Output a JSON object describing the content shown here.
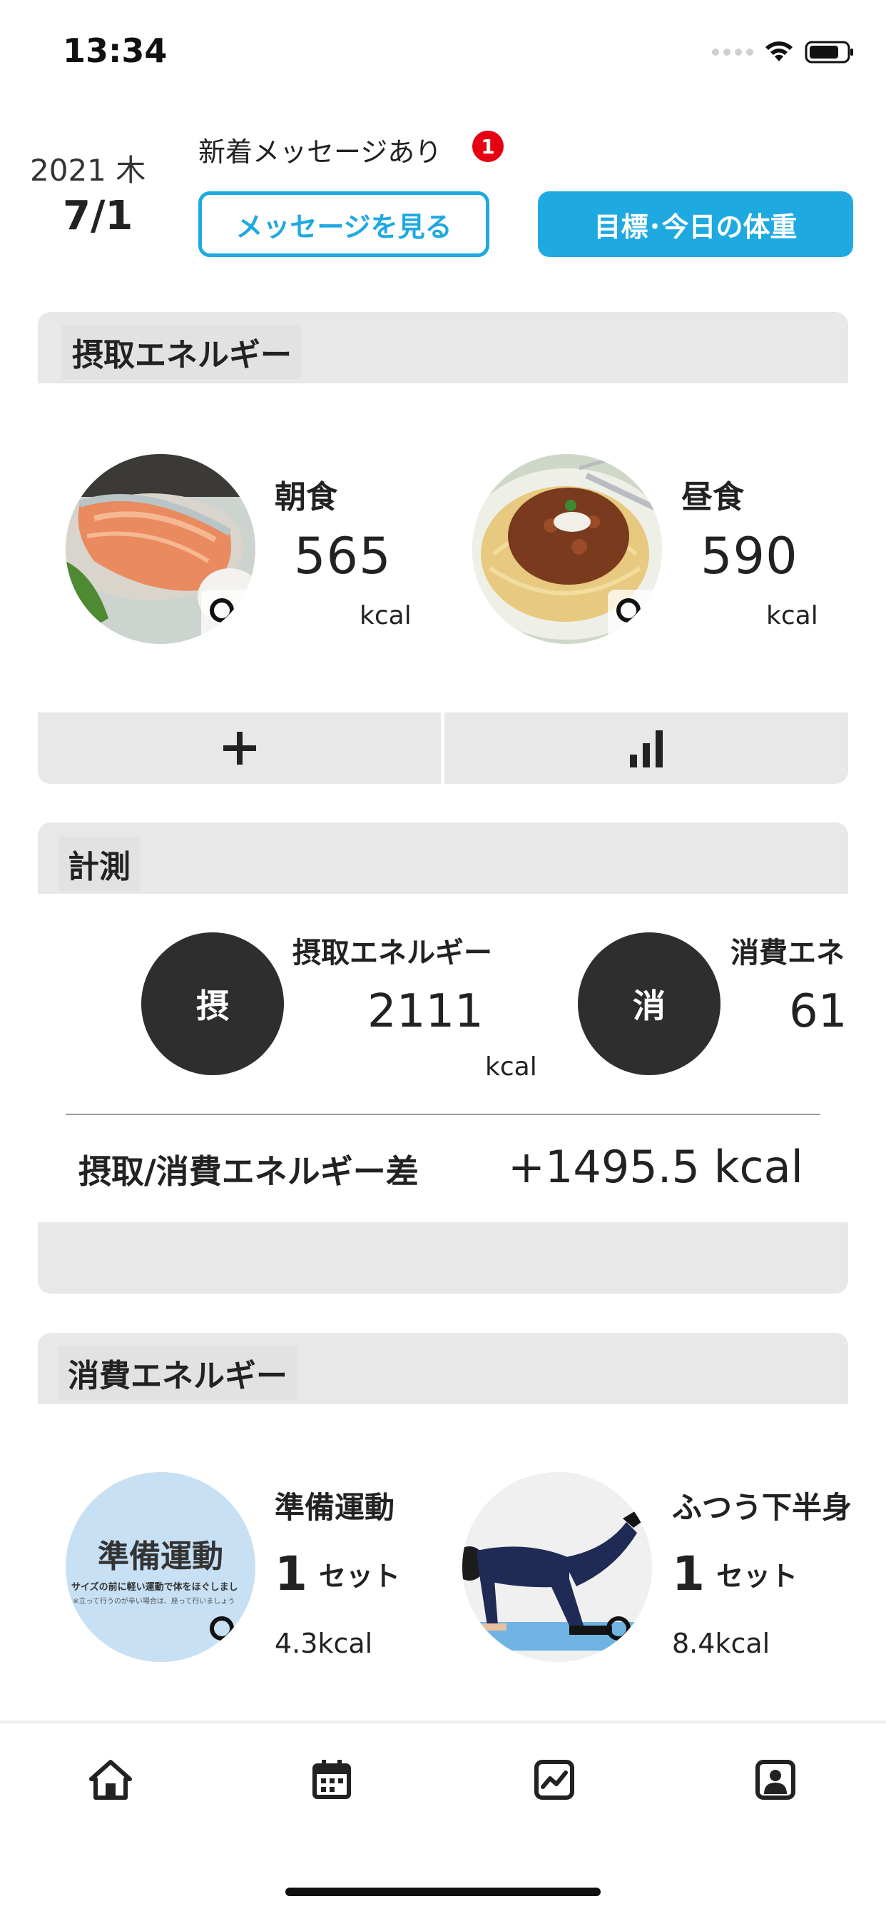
{
  "status": {
    "time": "13:34"
  },
  "header": {
    "year_weekday": "2021 木",
    "date": "7/1",
    "message_notice": "新着メッセージあり",
    "badge_count": "1",
    "view_messages_label": "メッセージを見る",
    "goal_weight_label": "目標･今日の体重",
    "accent_color": "#1fa9e1"
  },
  "intake": {
    "title": "摂取エネルギー",
    "meals": [
      {
        "label": "朝食",
        "value": "565",
        "unit": "kcal",
        "photo": "grilled-salmon"
      },
      {
        "label": "昼食",
        "value": "590",
        "unit": "kcal",
        "photo": "meat-sauce-spaghetti"
      }
    ],
    "add_icon": "plus-icon",
    "chart_icon": "bar-chart-icon"
  },
  "measure": {
    "title": "計測",
    "items": [
      {
        "badge": "摂",
        "label": "摂取エネルギー",
        "value": "2111",
        "unit": "kcal"
      },
      {
        "badge": "消",
        "label": "消費エネ",
        "value": "61"
      }
    ],
    "diff_label": "摂取/消費エネルギー差",
    "diff_value": "+1495.5 kcal"
  },
  "burn": {
    "title": "消費エネルギー",
    "exercises": [
      {
        "label": "準備運動",
        "count": "1",
        "count_unit": "セット",
        "kcal": "4.3kcal",
        "thumb_title": "準備運動",
        "thumb_line1": "サイズの前に軽い運動で体をほぐしまし",
        "thumb_line2": "※立って行うのが辛い場合は、座って行いましょう"
      },
      {
        "label": "ふつう下半身",
        "count": "1",
        "count_unit": "セット",
        "kcal": "8.4kcal",
        "photo": "kneeling-leg-raise"
      }
    ]
  },
  "tabbar": {
    "items": [
      "home-icon",
      "calendar-icon",
      "trend-chart-icon",
      "profile-icon"
    ]
  }
}
